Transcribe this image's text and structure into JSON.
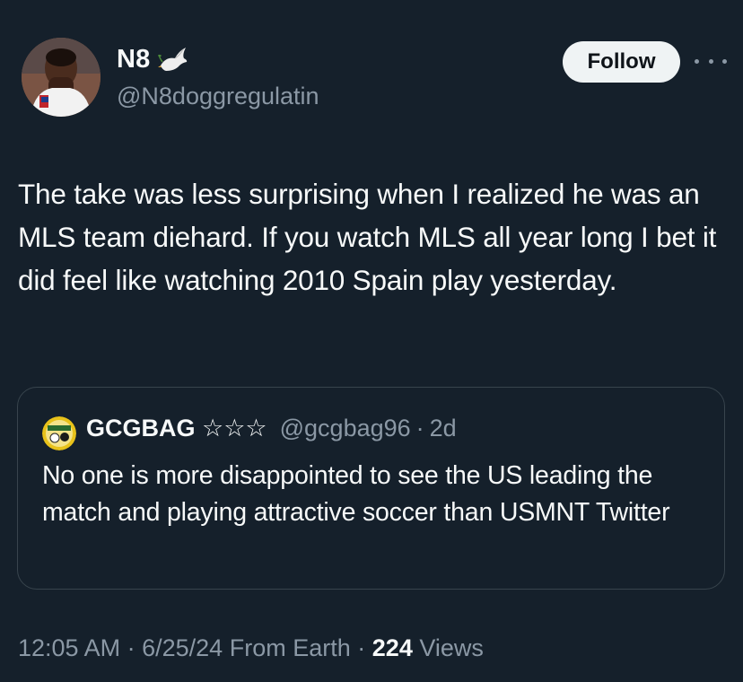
{
  "author": {
    "display_name": "N8",
    "handle": "@N8doggregulatin"
  },
  "actions": {
    "follow_label": "Follow"
  },
  "tweet": {
    "text": "The take was less surprising when I realized he was an MLS team diehard. If you watch MLS all year long I bet it did feel like watching 2010 Spain play yesterday."
  },
  "quote": {
    "name": "GCGBAG ☆☆☆",
    "handle": "@gcgbag96",
    "separator": "·",
    "time": "2d",
    "text": "No one is more disappointed to see the US leading the match and playing attractive soccer than USMNT Twitter"
  },
  "meta": {
    "time": "12:05 AM",
    "date": "6/25/24",
    "source": "From Earth",
    "separator": "·",
    "views_count": "224",
    "views_label": "Views"
  },
  "colors": {
    "background": "#15202b",
    "text_primary": "#f7f9f9",
    "text_secondary": "#8b98a5",
    "border": "#38444d",
    "follow_bg": "#eff3f4"
  },
  "icons": {
    "name_emoji": "dove-icon",
    "more": "more-horizontal-icon"
  }
}
